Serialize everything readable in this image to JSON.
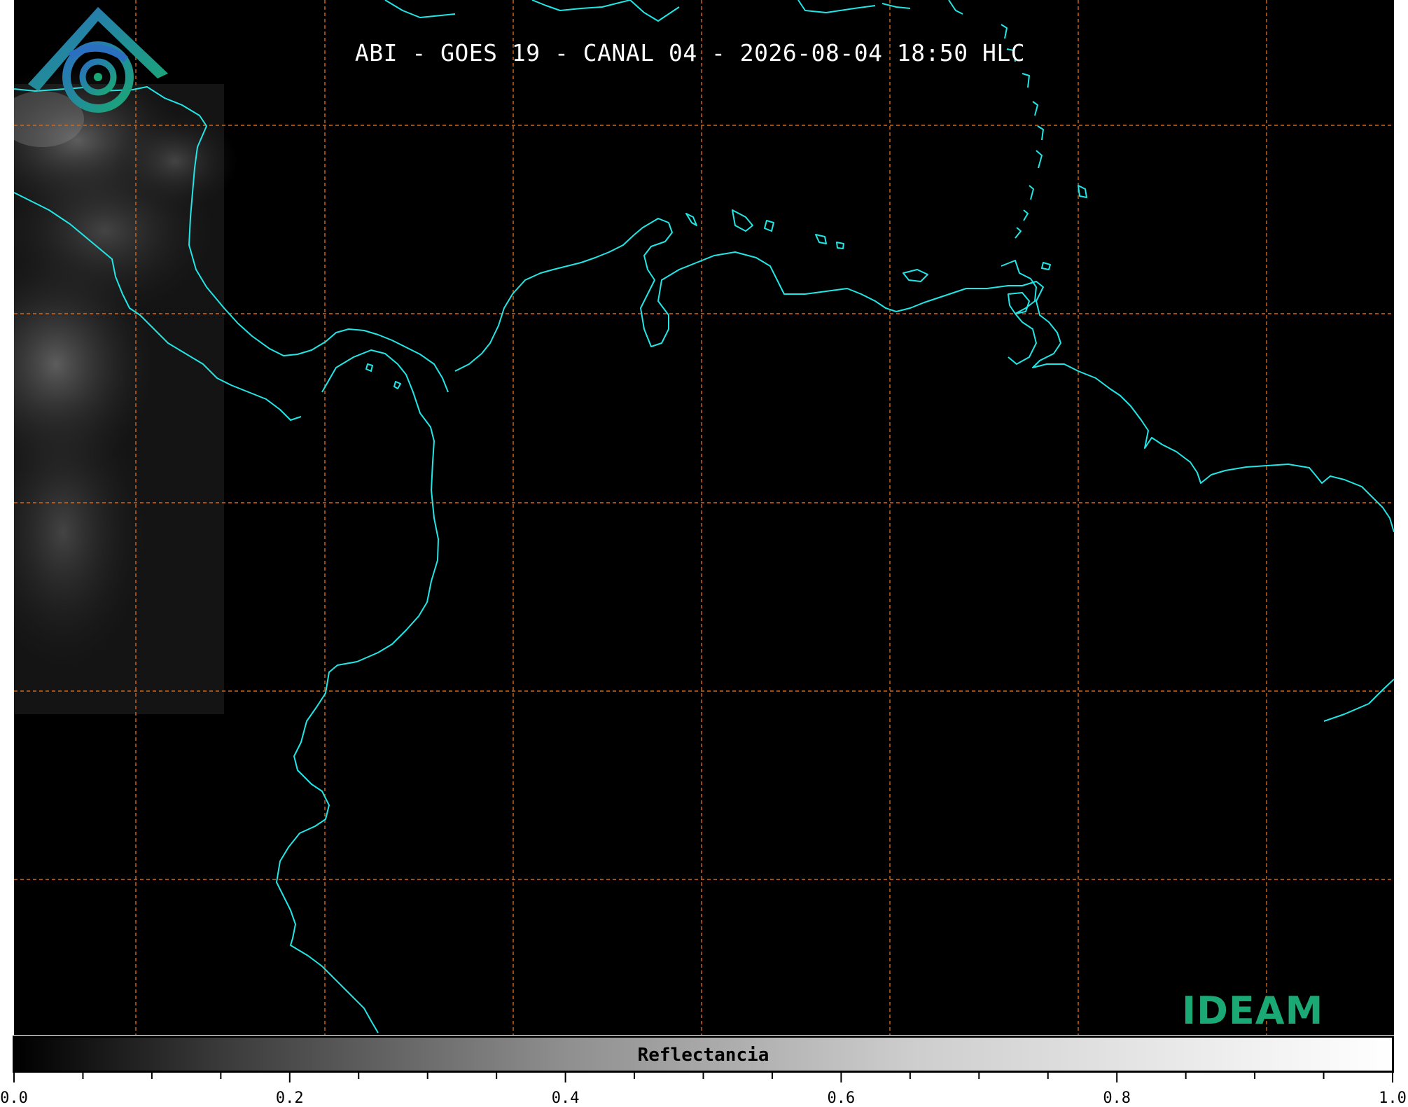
{
  "title": "ABI - GOES 19 - CANAL 04 - 2026-08-04 18:50 HLC",
  "colorbar": {
    "label": "Reflectancia",
    "ticks": [
      "0.0",
      "0.2",
      "0.4",
      "0.6",
      "0.8",
      "1.0"
    ],
    "min": 0.0,
    "max": 1.0
  },
  "logo": {
    "text": "IDEAM"
  },
  "colors": {
    "background": "#000000",
    "coastline": "#22e6e6",
    "graticule": "#d2691e",
    "logo_blue": "#2a6fc0",
    "logo_green": "#1aa874"
  }
}
